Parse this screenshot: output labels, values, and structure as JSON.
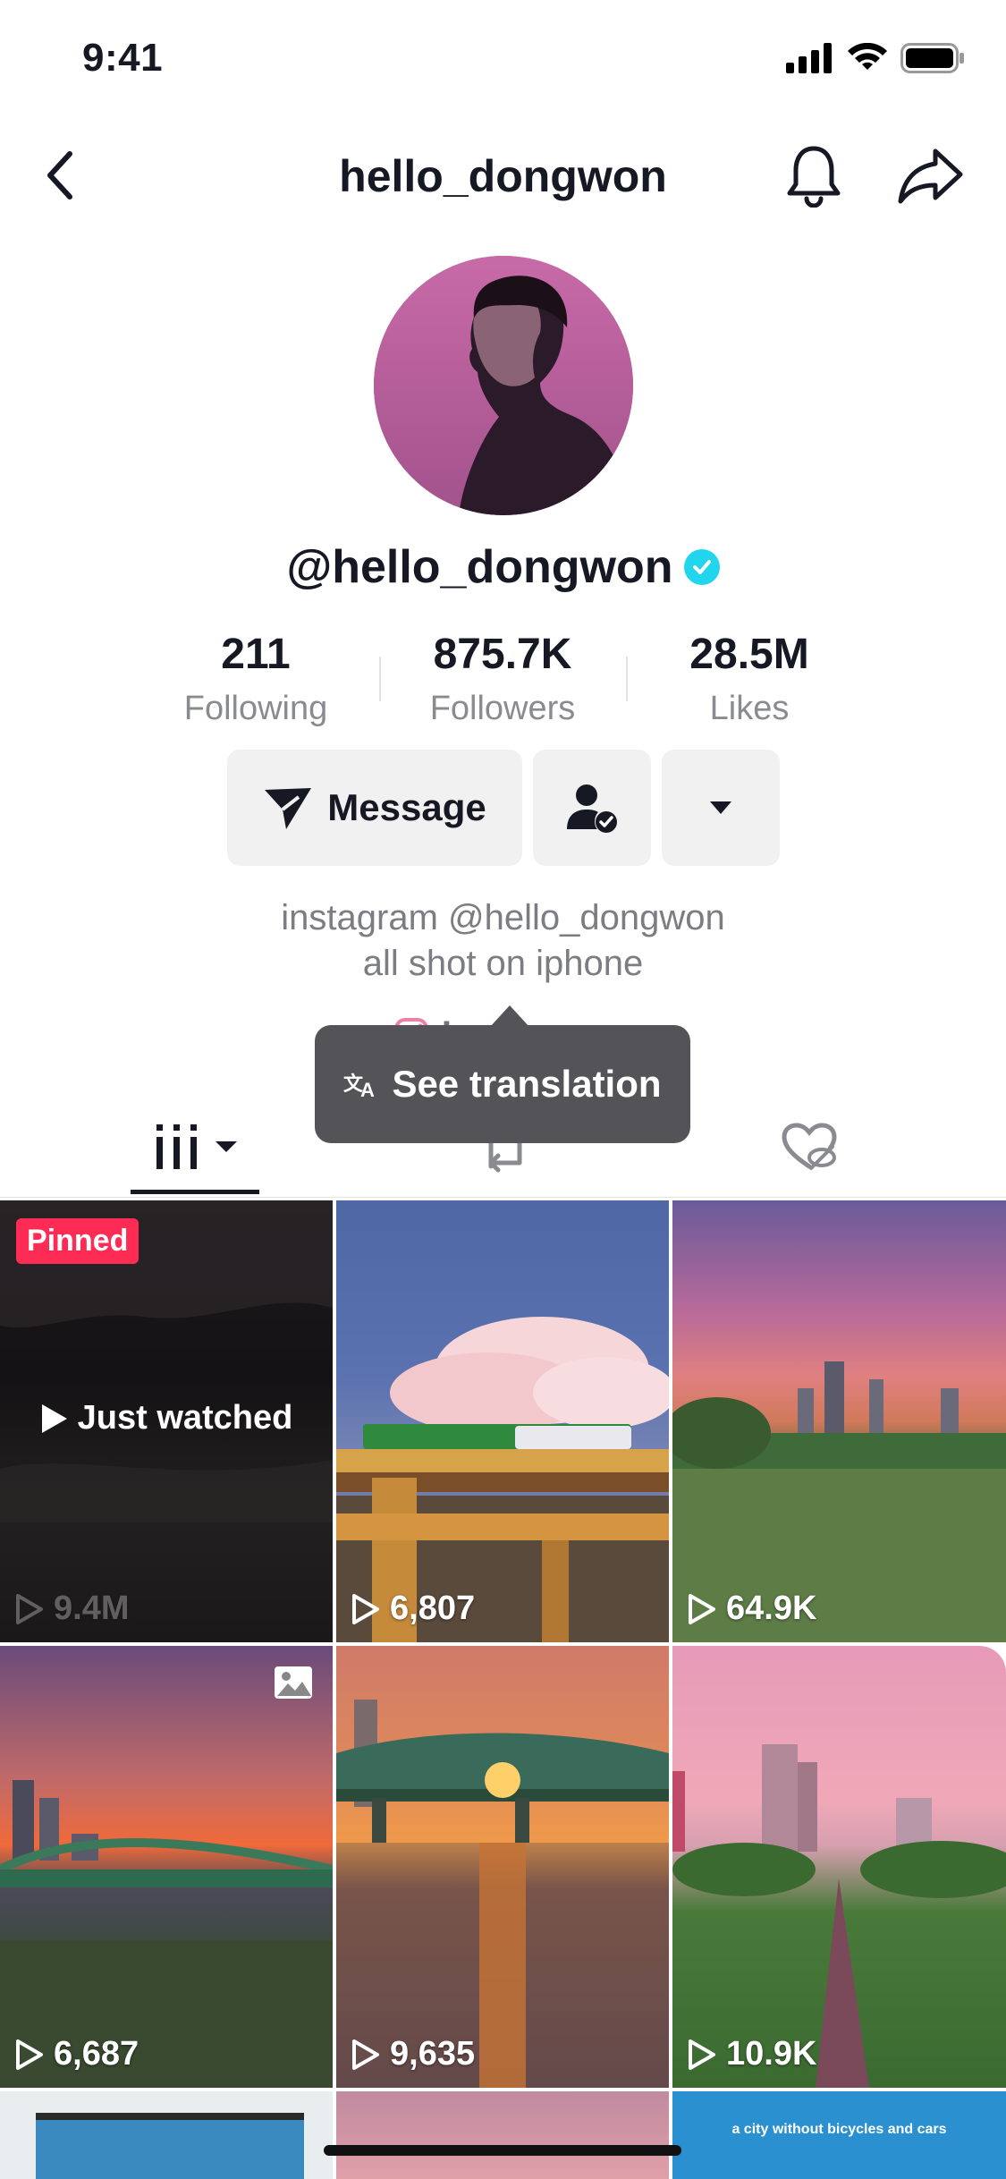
{
  "status_bar": {
    "time": "9:41"
  },
  "nav": {
    "title": "hello_dongwon"
  },
  "profile": {
    "handle": "@hello_dongwon",
    "verified_color": "#20d5ec",
    "stats": [
      {
        "value": "211",
        "label": "Following"
      },
      {
        "value": "875.7K",
        "label": "Followers"
      },
      {
        "value": "28.5M",
        "label": "Likes"
      }
    ],
    "buttons": {
      "message_label": "Message"
    },
    "bio_lines": [
      "instagram @hello_dongwon",
      "all shot on iphone"
    ],
    "instagram_link_label": "Instagram",
    "translation_tooltip": "See translation"
  },
  "tabs": [
    {
      "name": "videos",
      "icon": "grid-icon",
      "active": true
    },
    {
      "name": "reposts",
      "icon": "repost-icon",
      "active": false
    },
    {
      "name": "liked",
      "icon": "liked-hidden-icon",
      "active": false
    }
  ],
  "videos": [
    {
      "views": "9.4M",
      "pinned_label": "Pinned",
      "overlay": "Just watched"
    },
    {
      "views": "6,807"
    },
    {
      "views": "64.9K"
    },
    {
      "views": "6,687",
      "photo": true
    },
    {
      "views": "9,635"
    },
    {
      "views": "10.9K"
    }
  ],
  "bottom_row": {
    "third_tile_caption": "a city without bicycles and cars"
  },
  "colors": {
    "accent": "#fe2c55",
    "text": "#161823",
    "secondary": "#8a8b91"
  }
}
